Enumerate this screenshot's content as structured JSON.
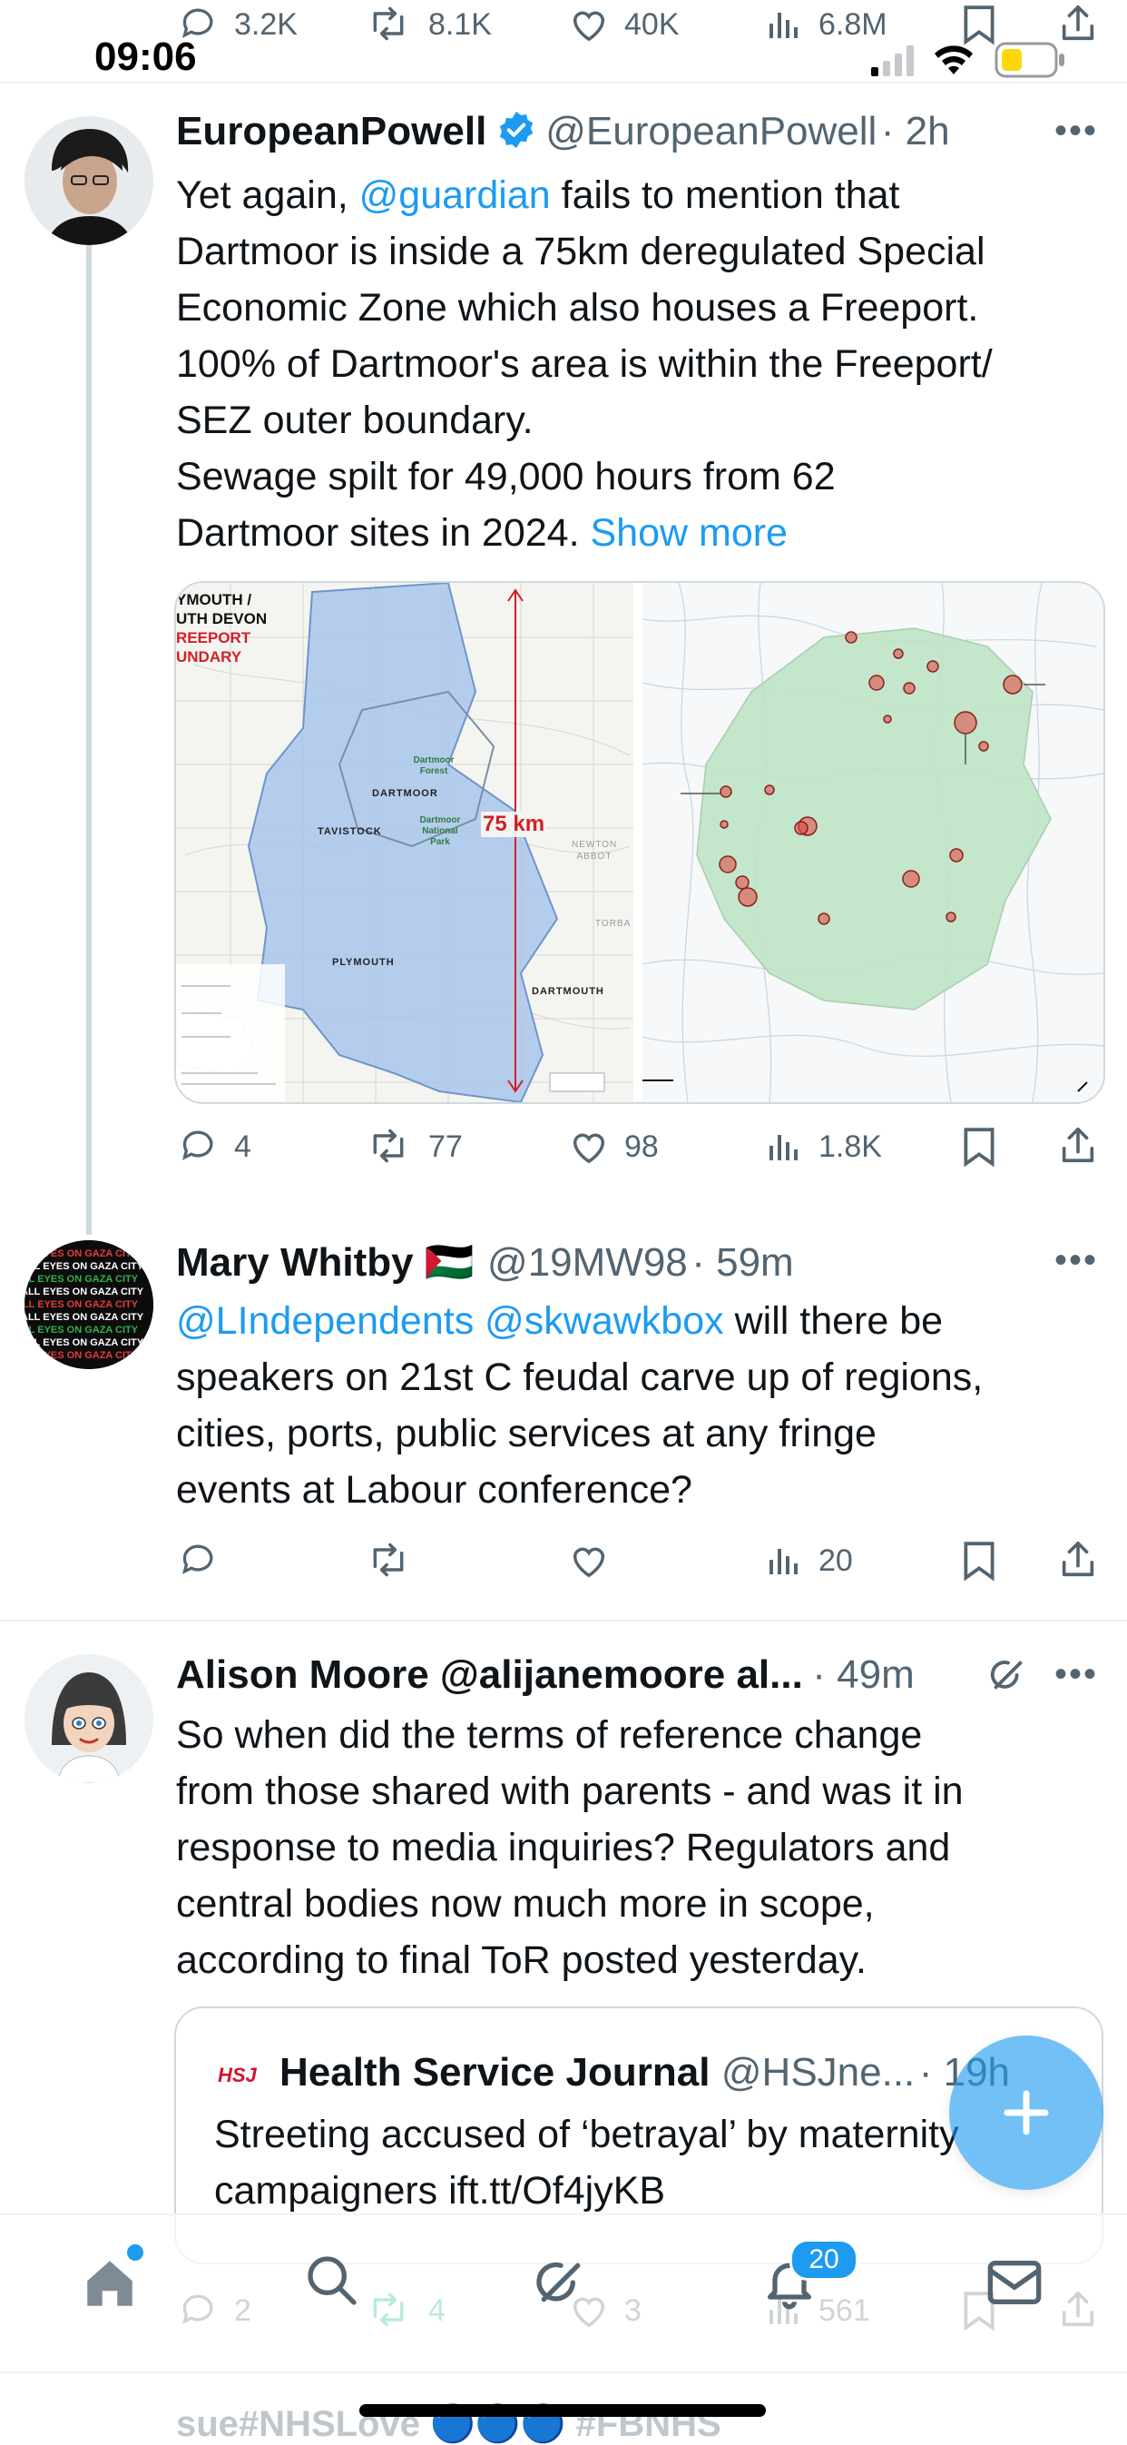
{
  "status_bar": {
    "time": "09:06"
  },
  "prev_tweet_actions": {
    "replies": "3.2K",
    "reposts": "8.1K",
    "likes": "40K",
    "views": "6.8M"
  },
  "tweets": [
    {
      "name": "EuropeanPowell",
      "handle": "@EuropeanPowell",
      "time": "· 2h",
      "text_pre": "Yet again, ",
      "mention": "@guardian",
      "text_lines": [
        " fails to mention that",
        "Dartmoor is inside a 75km deregulated Special",
        "Economic Zone which also houses a Freeport.",
        "100% of Dartmoor's area is within the Freeport/",
        "SEZ outer boundary.",
        "Sewage spilt for 49,000 hours from 62",
        "Dartmoor sites in 2024. "
      ],
      "show_more": "Show more",
      "map_left": {
        "title_lines": [
          "YMOUTH /",
          "UTH DEVON"
        ],
        "title_red_lines": [
          "REEPORT",
          "UNDARY"
        ],
        "labels": {
          "forest": "Dartmoor Forest",
          "dartmoor": "DARTMOOR",
          "tavistock": "TAVISTOCK",
          "park": "Dartmoor National Park",
          "newton": "NEWTON ABBOT",
          "torba": "TORBA",
          "plymouth": "PLYMOUTH",
          "dartmouth": "DARTMOUTH"
        },
        "distance": "75 km"
      },
      "actions": {
        "replies": "4",
        "reposts": "77",
        "likes": "98",
        "views": "1.8K"
      }
    },
    {
      "name": "Mary Whitby 🇵🇸",
      "handle": "@19MW98",
      "time": "· 59m",
      "mentions": "@LIndependents @skwawkbox",
      "text_first": " will there be",
      "text_lines": [
        "speakers on 21st C feudal carve up of regions,",
        "cities, ports, public services at any fringe",
        "events at Labour conference?"
      ],
      "avatar_text": "ALL EYES ON GAZA CITY",
      "actions": {
        "views": "20"
      }
    },
    {
      "name": "Alison Moore @alijanemoore al...",
      "time": "· 49m",
      "text_lines": [
        "So when did the terms of reference change",
        "from those shared with parents - and was it in",
        "response to media inquiries? Regulators and",
        "central bodies now much more in scope,",
        "according to final ToR posted yesterday."
      ],
      "quote": {
        "logo": "HSJ",
        "name": "Health Service Journal",
        "handle": "@HSJne...",
        "time": "· 19h",
        "text_lines": [
          "Streeting accused of ‘betrayal’ by maternity",
          "campaigners ift.tt/Of4jyKB"
        ]
      },
      "actions": {
        "replies": "2",
        "reposts": "4",
        "likes": "3",
        "views": "561"
      }
    }
  ],
  "next_tweet_peek": "sue#NHSLove 🔵🔵🔵 #FBNHS",
  "nav": {
    "notification_count": "20"
  },
  "colors": {
    "accent": "#1d9bf0",
    "repost_active": "#00ba7c",
    "verified": "#1d9bf0"
  }
}
